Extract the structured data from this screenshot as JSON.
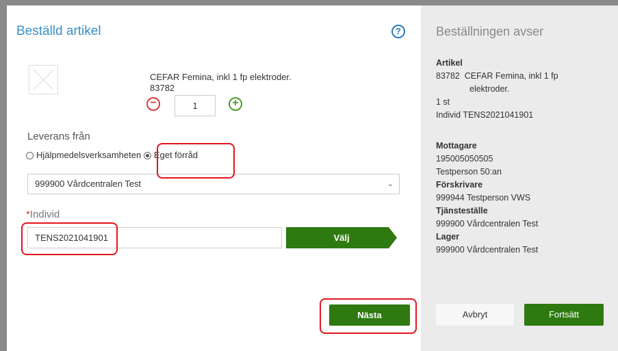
{
  "left": {
    "title": "Beställd artikel",
    "help_symbol": "?",
    "article": {
      "name": "CEFAR Femina, inkl 1 fp elektroder.",
      "number": "83782",
      "quantity": "1",
      "minus_symbol": "−",
      "plus_symbol": "+"
    },
    "leverans": {
      "label": "Leverans från",
      "options": [
        "Hjälpmedelsverksamheten",
        "Eget förråd"
      ],
      "selected": "Eget förråd"
    },
    "location_select": {
      "value": "999900 Vårdcentralen Test",
      "chevron": "⌄"
    },
    "individ": {
      "required_mark": "*",
      "label": "Individ",
      "value": "TENS2021041901",
      "choose_button": "Välj"
    },
    "next_button": "Nästa"
  },
  "right": {
    "title": "Beställningen avser",
    "artikel_heading": "Artikel",
    "artikel_number": "83782",
    "artikel_name_line1": "CEFAR Femina, inkl 1 fp",
    "artikel_name_line2": "elektroder.",
    "artikel_qty": "1 st",
    "artikel_individ": "Individ TENS2021041901",
    "mottagare_heading": "Mottagare",
    "mottagare_id": "195005050505",
    "mottagare_name": "Testperson 50:an",
    "forskrivare_heading": "Förskrivare",
    "forskrivare_value": "999944 Testperson VWS",
    "tjanstestalle_heading": "Tjänsteställe",
    "tjanstestalle_value": "999900 Vårdcentralen Test",
    "lager_heading": "Lager",
    "lager_value": "999900 Vårdcentralen Test",
    "cancel_button": "Avbryt",
    "continue_button": "Fortsätt"
  },
  "colors": {
    "accent_title": "#3a8fc6",
    "primary_button": "#2e7a10",
    "highlight": "#e0141b",
    "minus": "#d23b3b",
    "plus": "#4a9d2a"
  }
}
